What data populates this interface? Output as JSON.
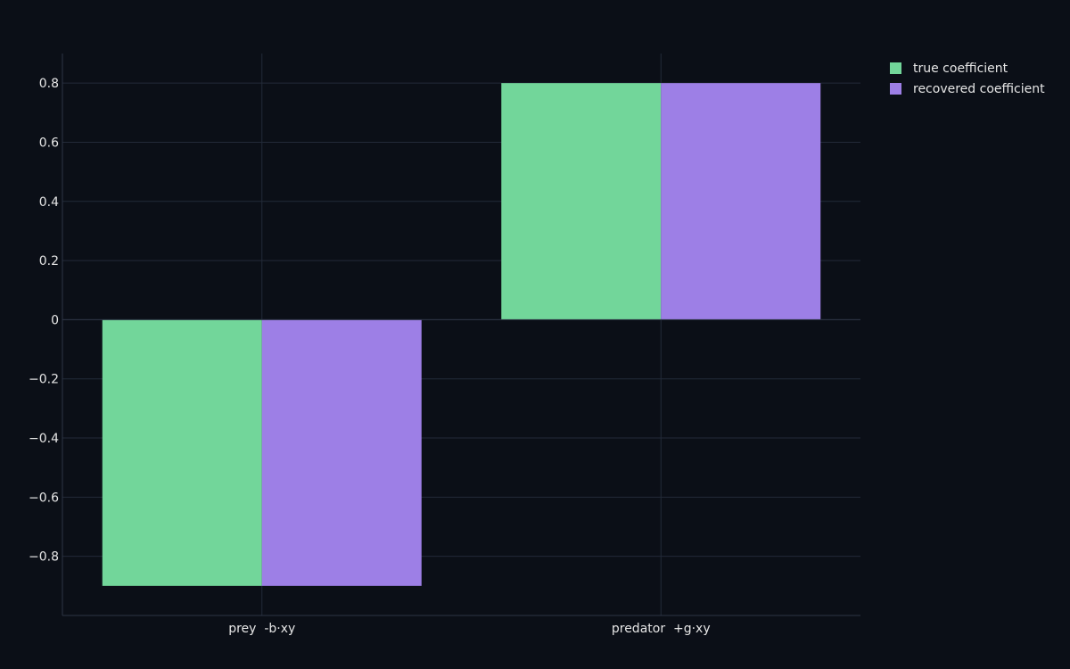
{
  "chart_data": {
    "type": "bar",
    "title": "",
    "xlabel": "",
    "ylabel": "",
    "categories": [
      "prey  -b·xy",
      "predator  +g·xy"
    ],
    "series": [
      {
        "name": "true coefficient",
        "values": [
          -0.9,
          0.8
        ],
        "color": "#72d69a"
      },
      {
        "name": "recovered coefficient",
        "values": [
          -0.9,
          0.8
        ],
        "color": "#9d7fe6"
      }
    ],
    "ylim": [
      -1.0,
      0.9
    ],
    "yticks": [
      0.8,
      0.6,
      0.4,
      0.2,
      0,
      -0.2,
      -0.4,
      -0.6,
      -0.8
    ],
    "ytick_labels": [
      "0.8",
      "0.6",
      "0.4",
      "0.2",
      "0",
      "−0.2",
      "−0.4",
      "−0.6",
      "−0.8"
    ],
    "grid": true,
    "legend_position": "top-right",
    "colors": {
      "background": "#0b0f17",
      "grid": "#232a38",
      "text": "#e6e6e6"
    }
  }
}
